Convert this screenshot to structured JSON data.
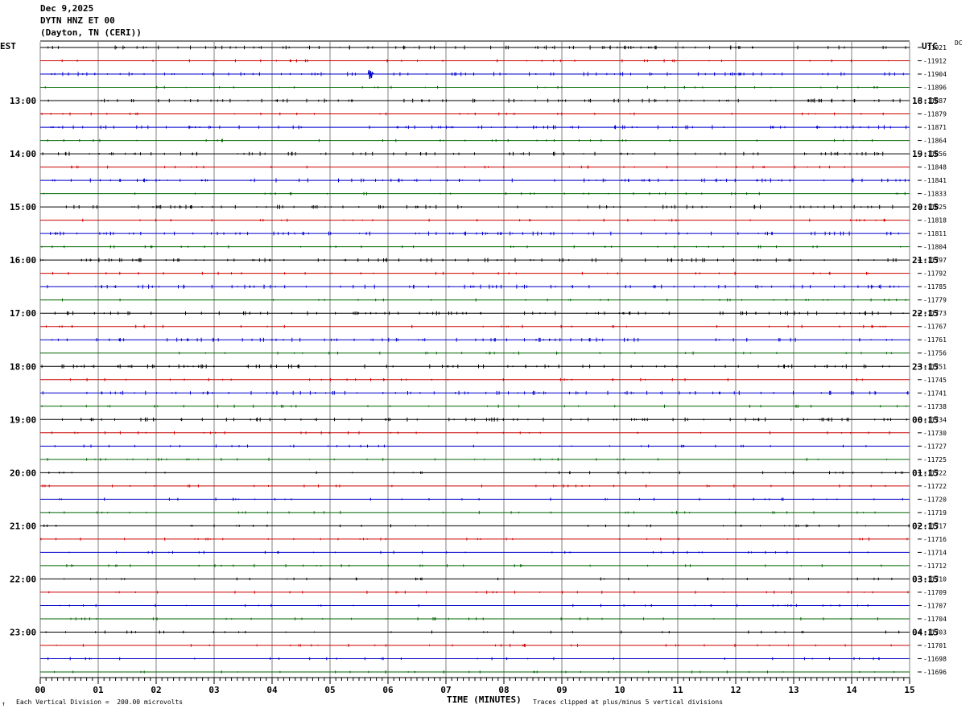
{
  "header": {
    "date": "Dec 9,2025",
    "station": "DYTN HNZ ET 00",
    "location": "(Dayton, TN (CERI))"
  },
  "left_tz": "EST",
  "right_tz": "UTC",
  "dc_label": "DC",
  "footer": {
    "left_mark": "↑",
    "scale_text": "Each Vertical Division =  200.00 microvolts",
    "xlabel": "TIME (MINUTES)",
    "clip_text": "Traces clipped at plus/minus 5 vertical divisions"
  },
  "colors": {
    "trace_cycle": [
      "#000000",
      "#cc0000",
      "#0000cc",
      "#006600"
    ],
    "grid": "#808080"
  },
  "chart_data": {
    "type": "line",
    "title": "",
    "xlabel": "TIME (MINUTES)",
    "xlim": [
      0,
      15
    ],
    "x_ticks": [
      "00",
      "01",
      "02",
      "03",
      "04",
      "05",
      "06",
      "07",
      "08",
      "09",
      "10",
      "11",
      "12",
      "13",
      "14",
      "15"
    ],
    "left_hour_labels": [
      "13:00",
      "14:00",
      "15:00",
      "16:00",
      "17:00",
      "18:00",
      "19:00",
      "20:00",
      "21:00",
      "22:00",
      "23:00"
    ],
    "right_hour_labels": [
      "18:15",
      "19:15",
      "20:15",
      "21:15",
      "22:15",
      "23:15",
      "00:15",
      "01:15",
      "02:15",
      "03:15",
      "04:15"
    ],
    "dc_offsets": [
      "-11921",
      "-11912",
      "-11904",
      "-11896",
      "-11887",
      "-11879",
      "-11871",
      "-11864",
      "-11856",
      "-11848",
      "-11841",
      "-11833",
      "-11825",
      "-11818",
      "-11811",
      "-11804",
      "-11797",
      "-11792",
      "-11785",
      "-11779",
      "-11773",
      "-11767",
      "-11761",
      "-11756",
      "-11751",
      "-11745",
      "-11741",
      "-11738",
      "-11734",
      "-11730",
      "-11727",
      "-11725",
      "-11722",
      "-11722",
      "-11720",
      "-11719",
      "-11717",
      "-11716",
      "-11714",
      "-11712",
      "-11710",
      "-11709",
      "-11707",
      "-11704",
      "-11703",
      "-11701",
      "-11698",
      "-11696"
    ],
    "traces_count": 48,
    "event": {
      "trace": 2,
      "minute": 5.7
    }
  }
}
